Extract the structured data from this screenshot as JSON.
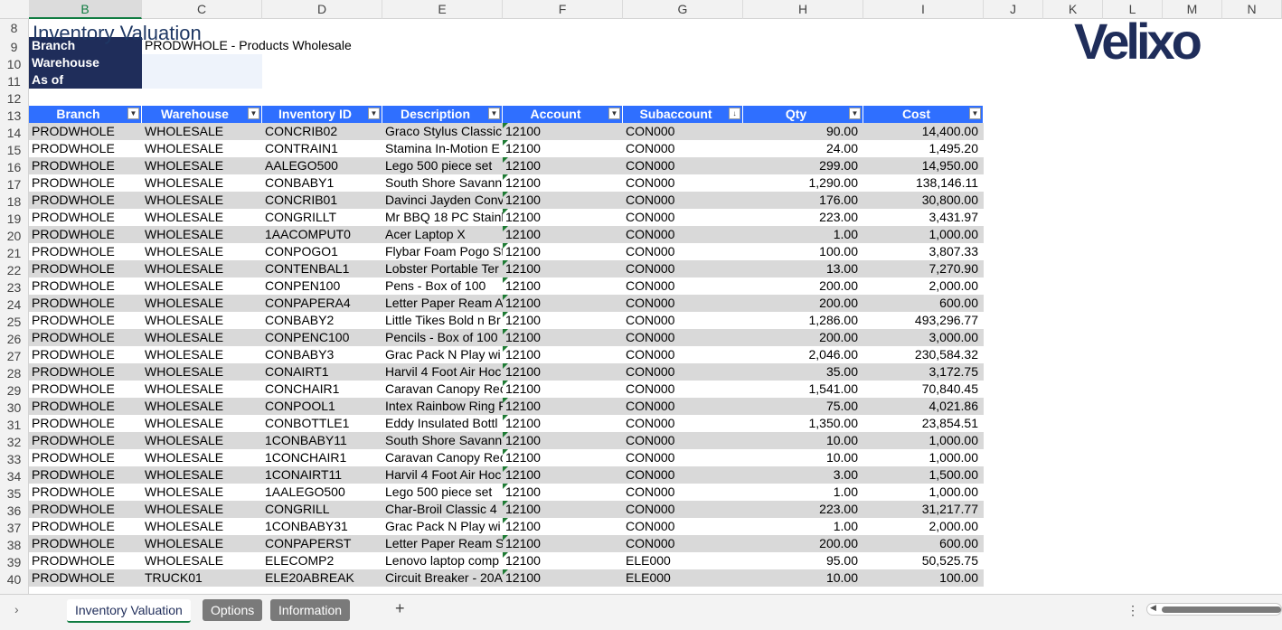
{
  "columns": [
    "B",
    "C",
    "D",
    "E",
    "F",
    "G",
    "H",
    "I",
    "J",
    "K",
    "L",
    "M",
    "N"
  ],
  "selected_column": "B",
  "title": "Inventory Valuation",
  "logo_text": "Velixo",
  "params": [
    {
      "label": "Branch",
      "value": "PRODWHOLE - Products Wholesale"
    },
    {
      "label": "Warehouse",
      "value": ""
    },
    {
      "label": "As of",
      "value": ""
    }
  ],
  "table_headers": [
    "Branch",
    "Warehouse",
    "Inventory ID",
    "Description",
    "Account",
    "Subaccount",
    "Qty",
    "Cost"
  ],
  "first_row_number": 8,
  "rows": [
    [
      "PRODWHOLE",
      "WHOLESALE",
      "CONCRIB02",
      "Graco Stylus Classic",
      "12100",
      "CON000",
      "90.00",
      "14,400.00"
    ],
    [
      "PRODWHOLE",
      "WHOLESALE",
      "CONTRAIN1",
      "Stamina In-Motion E",
      "12100",
      "CON000",
      "24.00",
      "1,495.20"
    ],
    [
      "PRODWHOLE",
      "WHOLESALE",
      "AALEGO500",
      "Lego 500 piece set",
      "12100",
      "CON000",
      "299.00",
      "14,950.00"
    ],
    [
      "PRODWHOLE",
      "WHOLESALE",
      "CONBABY1",
      "South Shore Savanna",
      "12100",
      "CON000",
      "1,290.00",
      "138,146.11"
    ],
    [
      "PRODWHOLE",
      "WHOLESALE",
      "CONCRIB01",
      "Davinci Jayden Conv",
      "12100",
      "CON000",
      "176.00",
      "30,800.00"
    ],
    [
      "PRODWHOLE",
      "WHOLESALE",
      "CONGRILLT",
      "Mr BBQ 18 PC Stainl",
      "12100",
      "CON000",
      "223.00",
      "3,431.97"
    ],
    [
      "PRODWHOLE",
      "WHOLESALE",
      "1AACOMPUT0",
      "Acer Laptop X",
      "12100",
      "CON000",
      "1.00",
      "1,000.00"
    ],
    [
      "PRODWHOLE",
      "WHOLESALE",
      "CONPOGO1",
      "Flybar Foam Pogo St",
      "12100",
      "CON000",
      "100.00",
      "3,807.33"
    ],
    [
      "PRODWHOLE",
      "WHOLESALE",
      "CONTENBAL1",
      "Lobster Portable Ter",
      "12100",
      "CON000",
      "13.00",
      "7,270.90"
    ],
    [
      "PRODWHOLE",
      "WHOLESALE",
      "CONPEN100",
      "Pens - Box of 100",
      "12100",
      "CON000",
      "200.00",
      "2,000.00"
    ],
    [
      "PRODWHOLE",
      "WHOLESALE",
      "CONPAPERA4",
      "Letter Paper Ream A",
      "12100",
      "CON000",
      "200.00",
      "600.00"
    ],
    [
      "PRODWHOLE",
      "WHOLESALE",
      "CONBABY2",
      "Little Tikes Bold n Br",
      "12100",
      "CON000",
      "1,286.00",
      "493,296.77"
    ],
    [
      "PRODWHOLE",
      "WHOLESALE",
      "CONPENC100",
      "Pencils - Box of 100",
      "12100",
      "CON000",
      "200.00",
      "3,000.00"
    ],
    [
      "PRODWHOLE",
      "WHOLESALE",
      "CONBABY3",
      "Grac Pack N Play wi",
      "12100",
      "CON000",
      "2,046.00",
      "230,584.32"
    ],
    [
      "PRODWHOLE",
      "WHOLESALE",
      "CONAIRT1",
      "Harvil 4 Foot Air Hoc",
      "12100",
      "CON000",
      "35.00",
      "3,172.75"
    ],
    [
      "PRODWHOLE",
      "WHOLESALE",
      "CONCHAIR1",
      "Caravan Canopy Rec",
      "12100",
      "CON000",
      "1,541.00",
      "70,840.45"
    ],
    [
      "PRODWHOLE",
      "WHOLESALE",
      "CONPOOL1",
      "Intex Rainbow Ring F",
      "12100",
      "CON000",
      "75.00",
      "4,021.86"
    ],
    [
      "PRODWHOLE",
      "WHOLESALE",
      "CONBOTTLE1",
      "Eddy Insulated Bottl",
      "12100",
      "CON000",
      "1,350.00",
      "23,854.51"
    ],
    [
      "PRODWHOLE",
      "WHOLESALE",
      "1CONBABY11",
      "South Shore Savanna",
      "12100",
      "CON000",
      "10.00",
      "1,000.00"
    ],
    [
      "PRODWHOLE",
      "WHOLESALE",
      "1CONCHAIR1",
      "Caravan Canopy Rec",
      "12100",
      "CON000",
      "10.00",
      "1,000.00"
    ],
    [
      "PRODWHOLE",
      "WHOLESALE",
      "1CONAIRT11",
      "Harvil 4 Foot Air Hoc",
      "12100",
      "CON000",
      "3.00",
      "1,500.00"
    ],
    [
      "PRODWHOLE",
      "WHOLESALE",
      "1AALEGO500",
      "Lego 500 piece set",
      "12100",
      "CON000",
      "1.00",
      "1,000.00"
    ],
    [
      "PRODWHOLE",
      "WHOLESALE",
      "CONGRILL",
      "Char-Broil Classic 4",
      "12100",
      "CON000",
      "223.00",
      "31,217.77"
    ],
    [
      "PRODWHOLE",
      "WHOLESALE",
      "1CONBABY31",
      "Grac Pack N Play wi",
      "12100",
      "CON000",
      "1.00",
      "2,000.00"
    ],
    [
      "PRODWHOLE",
      "WHOLESALE",
      "CONPAPERST",
      "Letter Paper Ream S",
      "12100",
      "CON000",
      "200.00",
      "600.00"
    ],
    [
      "PRODWHOLE",
      "WHOLESALE",
      "ELECOMP2",
      "Lenovo laptop comp",
      "12100",
      "ELE000",
      "95.00",
      "50,525.75"
    ],
    [
      "PRODWHOLE",
      "TRUCK01",
      "ELE20ABREAK",
      "Circuit Breaker - 20A",
      "12100",
      "ELE000",
      "10.00",
      "100.00"
    ]
  ],
  "tabs": [
    {
      "label": "Inventory Valuation",
      "active": true
    },
    {
      "label": "Options",
      "active": false
    },
    {
      "label": "Information",
      "active": false
    }
  ],
  "add_sheet": "+",
  "more": "⋮"
}
